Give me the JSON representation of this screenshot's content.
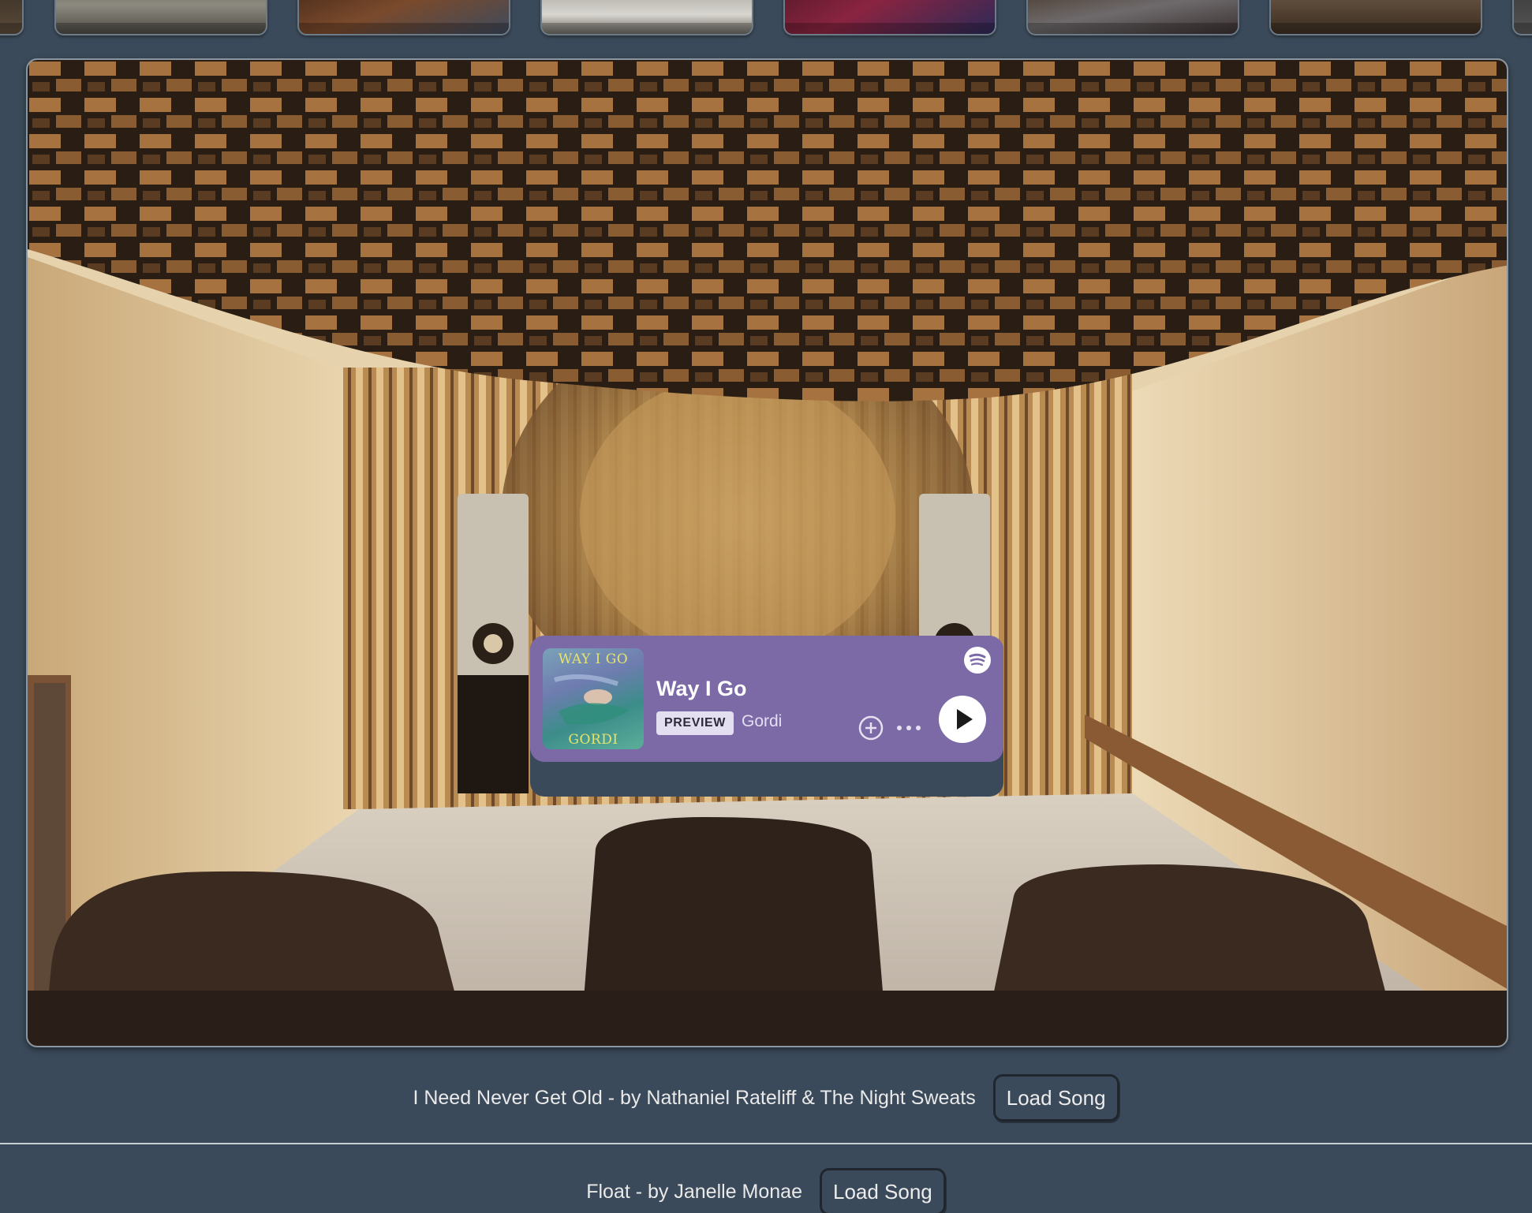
{
  "gallery": {
    "thumbnails": [
      "thumb-1",
      "thumb-2",
      "thumb-3",
      "thumb-4",
      "thumb-5",
      "thumb-6",
      "thumb-7",
      "thumb-8"
    ]
  },
  "embed": {
    "title": "Way I Go",
    "artist": "Gordi",
    "badge": "PREVIEW",
    "cover_top_text": "WAY I GO",
    "cover_bottom_text": "GORDI",
    "background_color": "#7c6aa7",
    "icons": [
      "spotify-icon",
      "add-icon",
      "more-icon",
      "play-icon"
    ]
  },
  "songs": [
    {
      "label": "I Need Never Get Old - by Nathaniel Rateliff & The Night Sweats",
      "button": "Load Song"
    },
    {
      "label": "Float - by Janelle Monae",
      "button": "Load Song"
    }
  ],
  "colors": {
    "page_background": "#3b4a5a",
    "divider": "#c9ced4"
  }
}
